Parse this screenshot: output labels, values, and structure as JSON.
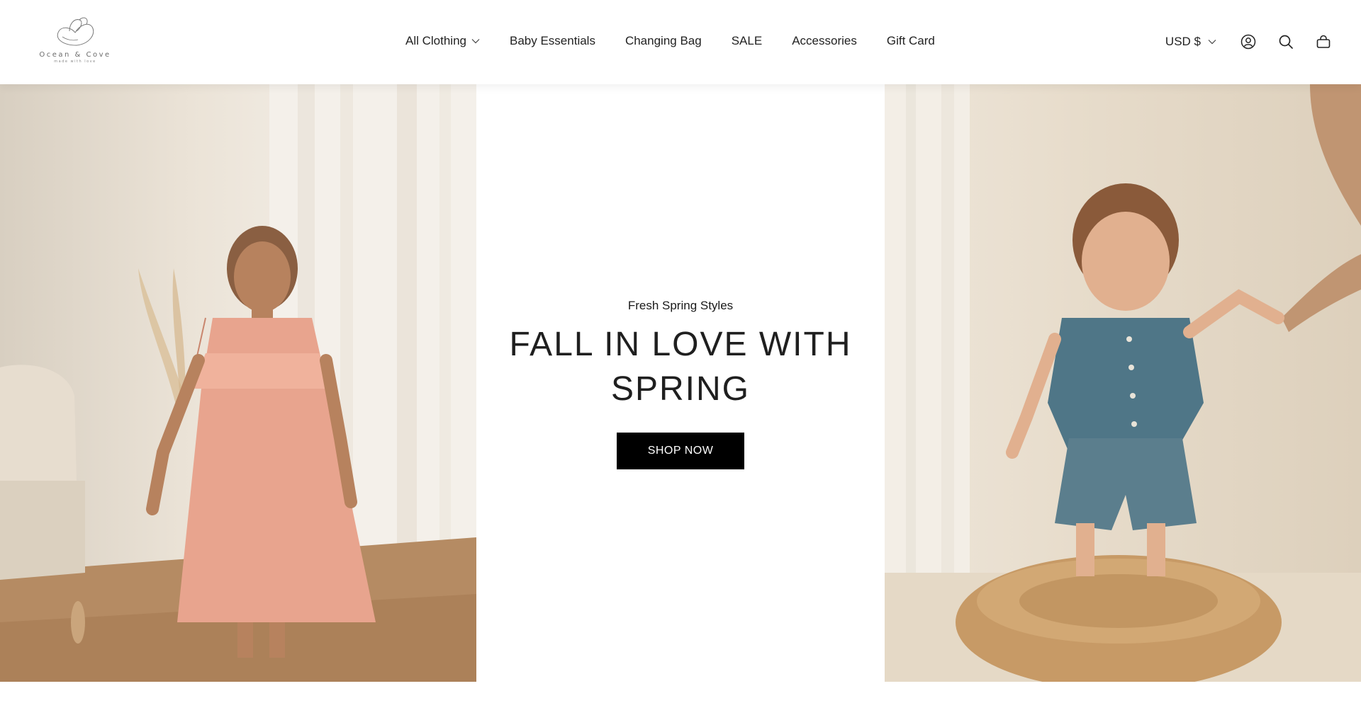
{
  "brand": {
    "name": "Ocean & Cove",
    "tagline": "made with love"
  },
  "nav": {
    "items": [
      {
        "label": "All Clothing",
        "has_dropdown": true,
        "icon": "chevron-down-icon"
      },
      {
        "label": "Baby Essentials",
        "has_dropdown": false
      },
      {
        "label": "Changing Bag",
        "has_dropdown": false
      },
      {
        "label": "SALE",
        "has_dropdown": false
      },
      {
        "label": "Accessories",
        "has_dropdown": false
      },
      {
        "label": "Gift Card",
        "has_dropdown": false
      }
    ]
  },
  "header_actions": {
    "currency": "USD $",
    "icons": [
      "account-icon",
      "search-icon",
      "cart-icon"
    ]
  },
  "hero": {
    "subheading": "Fresh Spring Styles",
    "heading": "FALL IN LOVE WITH SPRING",
    "cta_label": "SHOP NOW",
    "images": [
      {
        "name": "hero-image-girl-pink-dress"
      },
      {
        "name": "hero-image-toddler-denim-outfit"
      }
    ]
  },
  "colors": {
    "cta_background": "#000000",
    "cta_text": "#ffffff",
    "text": "#1a1a1a",
    "background": "#ffffff"
  }
}
